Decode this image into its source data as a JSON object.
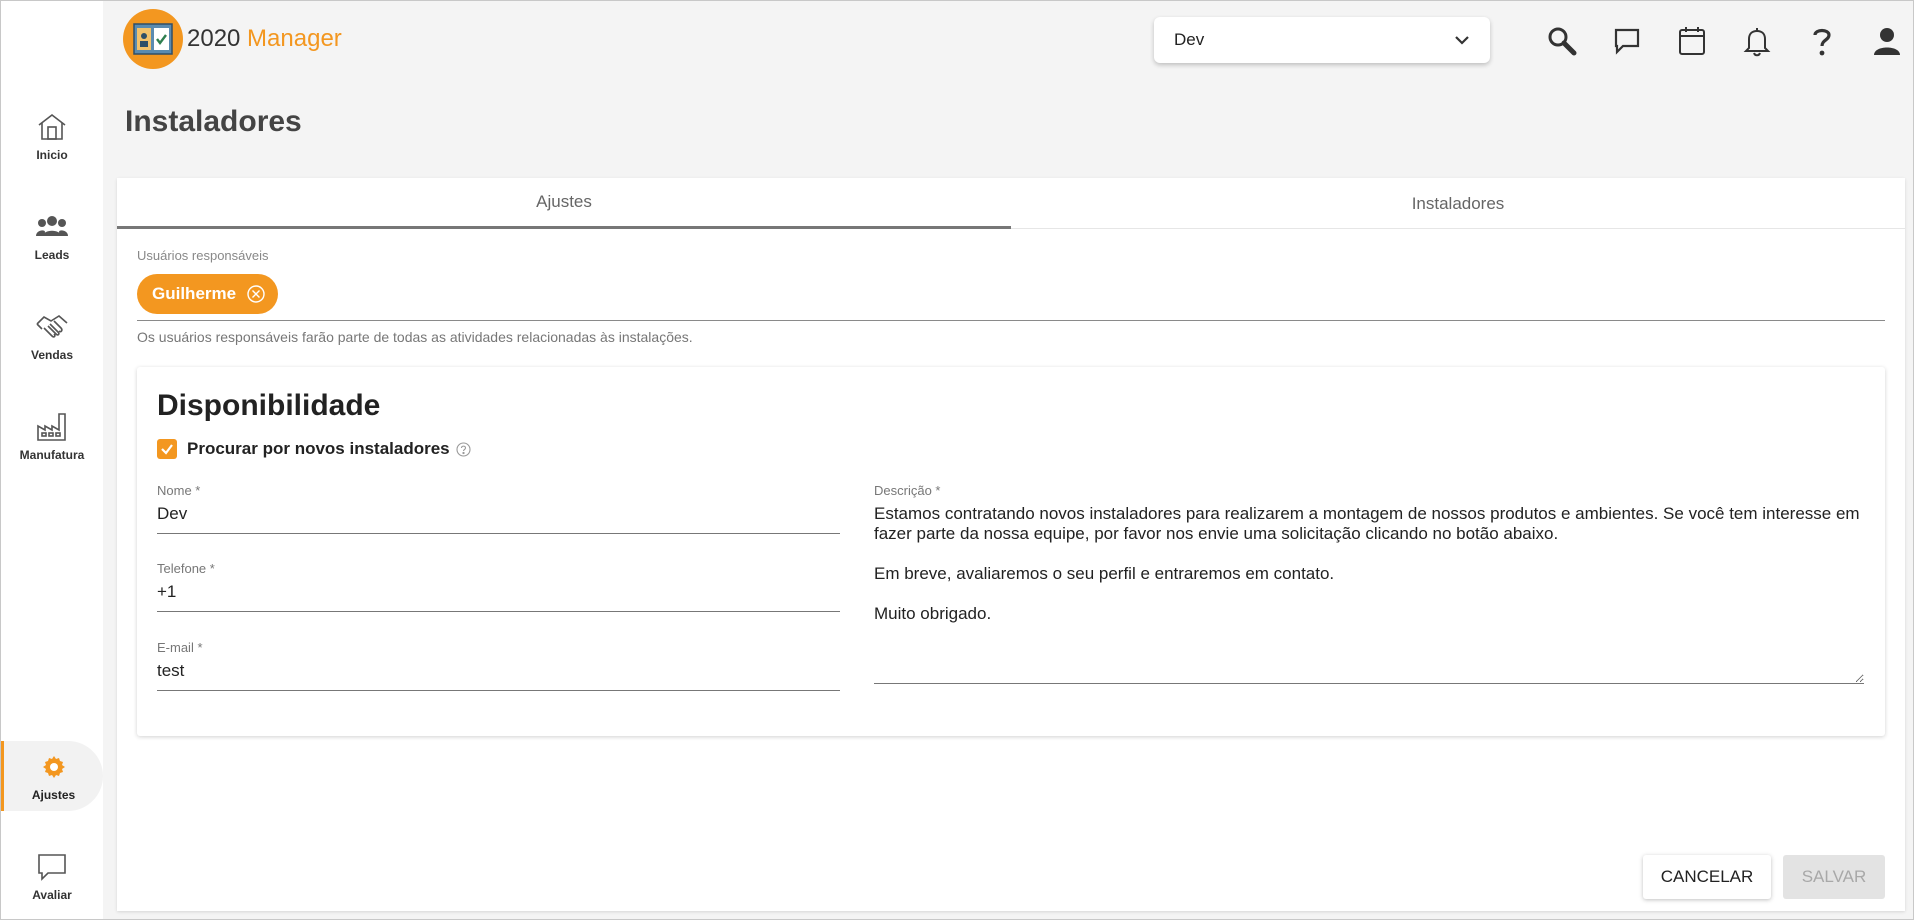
{
  "brand": {
    "name_prefix": "2020",
    "name_suffix": " Manager",
    "accent_color": "#f39720"
  },
  "sidebar": {
    "items": [
      {
        "label": "Inicio",
        "icon": "home-icon"
      },
      {
        "label": "Leads",
        "icon": "people-icon"
      },
      {
        "label": "Vendas",
        "icon": "handshake-icon"
      },
      {
        "label": "Manufatura",
        "icon": "factory-icon"
      },
      {
        "label": "Ajustes",
        "icon": "gear-icon",
        "active": true
      },
      {
        "label": "Avaliar",
        "icon": "feedback-icon"
      }
    ]
  },
  "header": {
    "environment": "Dev",
    "icons": [
      "search-icon",
      "chat-icon",
      "calendar-icon",
      "bell-icon",
      "help-icon",
      "user-icon"
    ]
  },
  "page": {
    "title": "Instaladores"
  },
  "tabs": [
    {
      "label": "Ajustes",
      "active": true
    },
    {
      "label": "Instaladores",
      "active": false
    }
  ],
  "responsible": {
    "label": "Usuários responsáveis",
    "chips": [
      "Guilherme"
    ],
    "hint": "Os usuários responsáveis farão parte de todas as atividades relacionadas às instalações."
  },
  "availability": {
    "title": "Disponibilidade",
    "checkbox_label": "Procurar por novos instaladores",
    "checked": true,
    "fields": {
      "name": {
        "label": "Nome *",
        "value": "Dev"
      },
      "phone": {
        "label": "Telefone *",
        "value": "+1"
      },
      "email": {
        "label": "E-mail *",
        "value": "test"
      },
      "description": {
        "label": "Descrição *",
        "value": "Estamos contratando novos instaladores para realizarem a montagem de nossos produtos e ambientes. Se você tem interesse em fazer parte da nossa equipe, por favor nos envie uma solicitação clicando no botão abaixo.\n\nEm breve, avaliaremos o seu perfil e entraremos em contato.\n\nMuito obrigado."
      }
    }
  },
  "actions": {
    "cancel": "CANCELAR",
    "save": "SALVAR"
  }
}
